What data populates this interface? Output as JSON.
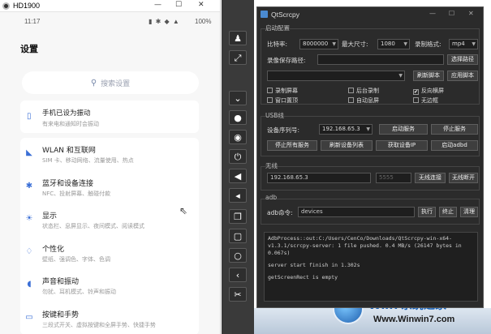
{
  "phone_window": {
    "title": "HD1900",
    "window_buttons": [
      "—",
      "☐",
      "✕"
    ],
    "status_bar": {
      "time": "11:17",
      "signal_icons": "▮ ✱ ◆ ▲",
      "battery": "100%"
    },
    "settings_title": "设置",
    "search_placeholder": "搜索设置",
    "notice": {
      "title": "手机已设为振动",
      "subtitle": "有来电和通知时会振动"
    },
    "items": [
      {
        "icon": "wifi-icon",
        "glyph": "◣",
        "title": "WLAN 和互联网",
        "subtitle": "SIM 卡、移动网络、流量使用、热点"
      },
      {
        "icon": "bluetooth-icon",
        "glyph": "✱",
        "title": "蓝牙和设备连接",
        "subtitle": "NFC、投射屏幕、触碰付款"
      },
      {
        "icon": "brightness-icon",
        "glyph": "☀",
        "title": "显示",
        "subtitle": "状态栏、息屏显示、夜间模式、阅读模式"
      },
      {
        "icon": "shirt-icon",
        "glyph": "♢",
        "title": "个性化",
        "subtitle": "壁纸、强调色、字体、色调"
      },
      {
        "icon": "speaker-icon",
        "glyph": "◖",
        "title": "声音和振动",
        "subtitle": "勿扰、耳机模式、铃声和振动"
      },
      {
        "icon": "button-icon",
        "glyph": "▭",
        "title": "按键和手势",
        "subtitle": "三段式开关、虚拟按键和全屏手势、快捷手势"
      }
    ]
  },
  "toolbar": {
    "buttons": [
      {
        "name": "group-control-icon",
        "glyph": "♟"
      },
      {
        "name": "fullscreen-icon",
        "glyph": "⤢"
      },
      {
        "name": "hide-toolbar-icon",
        "glyph": "⌄"
      },
      {
        "name": "record-dot-icon",
        "glyph": "●"
      },
      {
        "name": "eye-slash-icon",
        "glyph": "◉"
      },
      {
        "name": "power-icon",
        "glyph": "⏻"
      },
      {
        "name": "volume-up-icon",
        "glyph": "◀"
      },
      {
        "name": "volume-down-icon",
        "glyph": "◂"
      },
      {
        "name": "app-switch-icon",
        "glyph": "❐"
      },
      {
        "name": "home-icon",
        "glyph": "▢"
      },
      {
        "name": "circle-icon",
        "glyph": "○"
      },
      {
        "name": "back-icon",
        "glyph": "‹"
      },
      {
        "name": "scissors-icon",
        "glyph": "✂"
      }
    ]
  },
  "qt_window": {
    "title": "QtScrcpy",
    "window_buttons": [
      "—",
      "☐",
      "✕"
    ],
    "startup": {
      "group_title": "启动配置",
      "bitrate_label": "比特率:",
      "bitrate_value": "8000000",
      "max_size_label": "最大尺寸:",
      "max_size_value": "1080",
      "record_format_label": "录制格式:",
      "record_format_value": "mp4",
      "save_path_label": "录像保存路径:",
      "save_path_value": "",
      "select_path_button": "选择路径",
      "refresh_script_button": "刷新脚本",
      "apply_script_button": "应用脚本",
      "checkboxes": [
        {
          "label": "录制屏幕",
          "checked": ""
        },
        {
          "label": "后台录制",
          "checked": ""
        },
        {
          "label": "反向横屏",
          "checked": "✔"
        },
        {
          "label": "窗口置顶",
          "checked": ""
        },
        {
          "label": "自动息屏",
          "checked": ""
        },
        {
          "label": "无边框",
          "checked": ""
        }
      ]
    },
    "usb": {
      "group_title": "USB线",
      "serial_label": "设备序列号:",
      "serial_value": "192.168.65.3",
      "start_service_button": "启动服务",
      "stop_service_button": "停止服务",
      "stop_all_button": "停止所有服务",
      "refresh_devices_button": "刷新设备列表",
      "get_ip_button": "获取设备IP",
      "start_adbd_button": "启动adbd"
    },
    "wireless": {
      "group_title": "无线",
      "ip_value": "192.168.65.3",
      "port_placeholder": "5555",
      "connect_button": "无线连接",
      "disconnect_button": "无线断开"
    },
    "adb": {
      "group_title": "adb",
      "command_label": "adb命令:",
      "command_value": "devices",
      "execute_button": "执行",
      "stop_button": "终止",
      "clear_button": "清理"
    },
    "log_lines": [
      "AdbProcess::out:C:/Users/CenCo/Downloads/QtScrcpy-win-x64-v1.3.1/scrcpy-server: 1 file pushed. 0.4 MB/s (26147 bytes in 0.067s)",
      "",
      "server start finish in 1.302s",
      "",
      "getScreenRect is empty"
    ]
  },
  "watermark": {
    "brand_text": "Win7系统之家",
    "url": "Www.Winwin7.com"
  }
}
